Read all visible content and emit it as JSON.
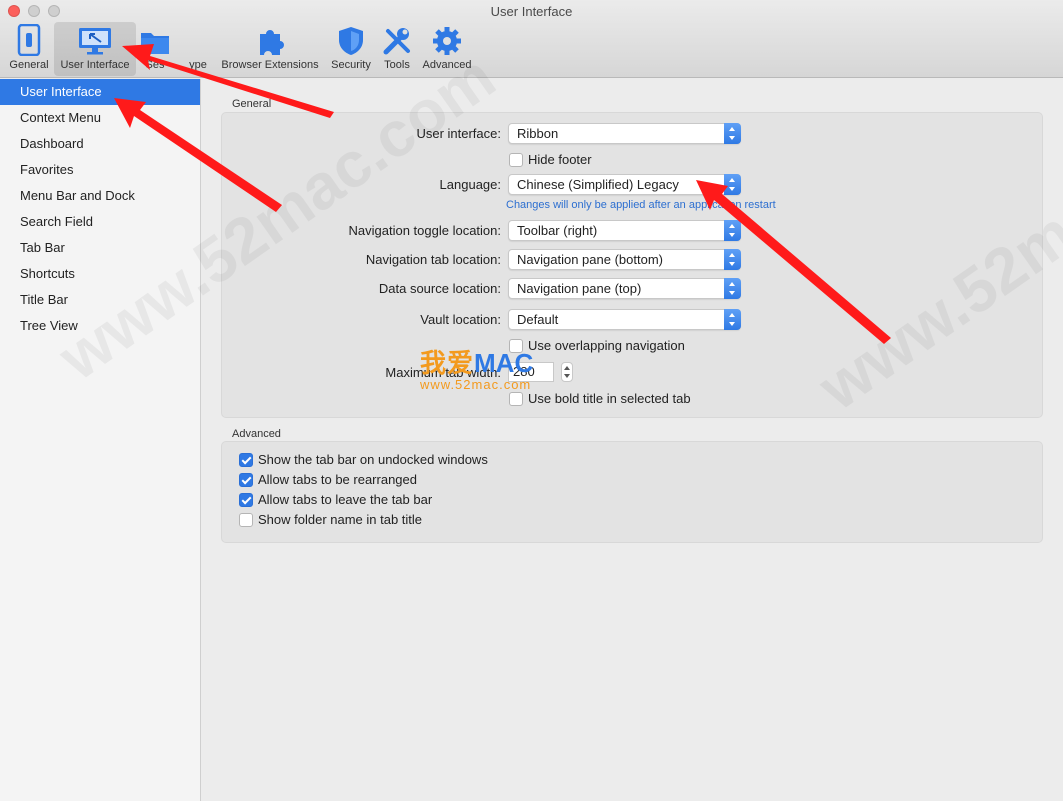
{
  "window": {
    "title": "User Interface"
  },
  "toolbar": {
    "items": [
      {
        "label": "General",
        "icon": "general-switch-icon"
      },
      {
        "label": "User Interface",
        "icon": "monitor-icon",
        "active": true
      },
      {
        "label": "Ses",
        "icon": "folder-icon"
      },
      {
        "label": "ype",
        "icon": "folder-icon"
      },
      {
        "label": "Browser Extensions",
        "icon": "puzzle-icon"
      },
      {
        "label": "Security",
        "icon": "shield-icon"
      },
      {
        "label": "Tools",
        "icon": "tools-icon"
      },
      {
        "label": "Advanced",
        "icon": "gear-icon"
      }
    ]
  },
  "sidebar": {
    "items": [
      {
        "label": "User Interface",
        "selected": true
      },
      {
        "label": "Context Menu"
      },
      {
        "label": "Dashboard"
      },
      {
        "label": "Favorites"
      },
      {
        "label": "Menu Bar and Dock"
      },
      {
        "label": "Search Field"
      },
      {
        "label": "Tab Bar"
      },
      {
        "label": "Shortcuts"
      },
      {
        "label": "Title Bar"
      },
      {
        "label": "Tree View"
      }
    ]
  },
  "general": {
    "title": "General",
    "user_interface": {
      "label": "User interface:",
      "value": "Ribbon"
    },
    "hide_footer": {
      "label": "Hide footer",
      "checked": false
    },
    "language": {
      "label": "Language:",
      "value": "Chinese (Simplified) Legacy"
    },
    "restart_note": "Changes will only be applied after an application restart",
    "nav_toggle": {
      "label": "Navigation toggle location:",
      "value": "Toolbar (right)"
    },
    "nav_tab": {
      "label": "Navigation tab location:",
      "value": "Navigation pane (bottom)"
    },
    "data_source": {
      "label": "Data source location:",
      "value": "Navigation pane (top)"
    },
    "vault": {
      "label": "Vault location:",
      "value": "Default"
    },
    "overlapping": {
      "label": "Use overlapping navigation",
      "checked": false
    },
    "max_tab_width": {
      "label": "Maximum tab width:",
      "value": "280"
    },
    "bold_title": {
      "label": "Use bold title in selected tab",
      "checked": false
    }
  },
  "advanced": {
    "title": "Advanced",
    "options": [
      {
        "label": "Show the tab bar on undocked windows",
        "checked": true
      },
      {
        "label": "Allow tabs to be rearranged",
        "checked": true
      },
      {
        "label": "Allow tabs to leave the tab bar",
        "checked": true
      },
      {
        "label": "Show folder name in tab title",
        "checked": false
      }
    ]
  },
  "watermark": {
    "logo_cn": "我爱",
    "logo_en": "MAC",
    "url": "www.52mac.com",
    "text": "www.52mac.com"
  },
  "colors": {
    "accent": "#2f79e4",
    "annotation": "#ff1a1a",
    "logo_orange": "#f39a1e"
  }
}
